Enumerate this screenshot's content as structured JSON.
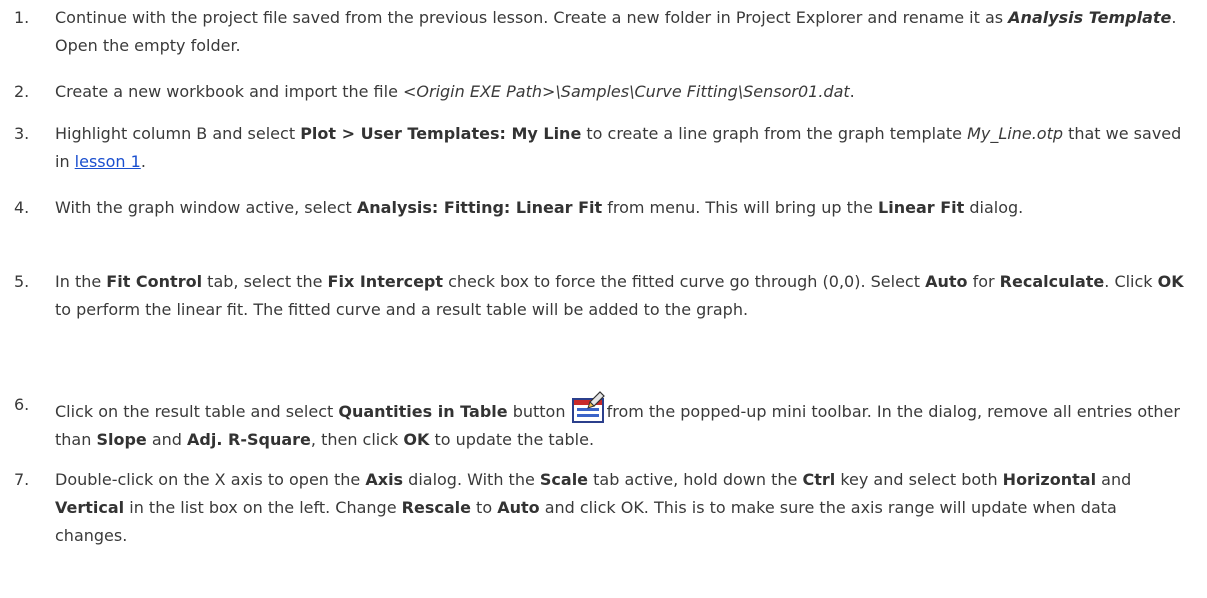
{
  "steps": [
    {
      "number": "1.",
      "parts": [
        {
          "t": "Continue with the project file saved from the previous lesson. Create a new folder in Project Explorer and rename it as "
        },
        {
          "t": "Analysis Template",
          "b": true,
          "i": true
        },
        {
          "t": ". Open the empty folder."
        }
      ]
    },
    {
      "number": "2.",
      "parts": [
        {
          "t": "Create a new workbook and import the file "
        },
        {
          "t": "<Origin EXE Path>\\Samples\\Curve Fitting\\Sensor01.dat",
          "i": true
        },
        {
          "t": "."
        }
      ]
    },
    {
      "number": "3.",
      "parts": [
        {
          "t": "Highlight column B and select "
        },
        {
          "t": "Plot > User Templates: My Line",
          "b": true
        },
        {
          "t": " to create a line graph from the graph template "
        },
        {
          "t": "My_Line.otp",
          "i": true
        },
        {
          "t": " that we saved in "
        },
        {
          "t": "lesson 1",
          "link": true
        },
        {
          "t": "."
        }
      ]
    },
    {
      "number": "4.",
      "parts": [
        {
          "t": "With the graph window active, select "
        },
        {
          "t": "Analysis: Fitting: Linear Fit",
          "b": true
        },
        {
          "t": " from menu. This will bring up the "
        },
        {
          "t": "Linear Fit",
          "b": true
        },
        {
          "t": " dialog."
        }
      ]
    },
    {
      "number": "5.",
      "parts": [
        {
          "t": "In the "
        },
        {
          "t": "Fit Control",
          "b": true
        },
        {
          "t": " tab, select the "
        },
        {
          "t": "Fix Intercept",
          "b": true
        },
        {
          "t": " check box to force the fitted curve go through (0,0). Select "
        },
        {
          "t": "Auto",
          "b": true
        },
        {
          "t": " for "
        },
        {
          "t": "Recalculate",
          "b": true
        },
        {
          "t": ". Click "
        },
        {
          "t": "OK",
          "b": true
        },
        {
          "t": " to perform the linear fit. The fitted curve and a result table will be added to the graph."
        }
      ]
    },
    {
      "number": "6.",
      "parts": [
        {
          "t": "Click on the result table and select "
        },
        {
          "t": "Quantities in Table",
          "b": true
        },
        {
          "t": " button "
        },
        {
          "icon": "quantities-in-table-icon"
        },
        {
          "t": "from the popped-up mini toolbar. In the dialog, remove all entries other than "
        },
        {
          "t": "Slope",
          "b": true
        },
        {
          "t": " and "
        },
        {
          "t": "Adj. R-Square",
          "b": true
        },
        {
          "t": ", then click "
        },
        {
          "t": "OK",
          "b": true
        },
        {
          "t": " to update the table."
        }
      ]
    },
    {
      "number": "7.",
      "parts": [
        {
          "t": "Double-click on the X axis to open the "
        },
        {
          "t": "Axis",
          "b": true
        },
        {
          "t": " dialog. With the "
        },
        {
          "t": "Scale",
          "b": true
        },
        {
          "t": " tab active, hold down the "
        },
        {
          "t": "Ctrl",
          "b": true
        },
        {
          "t": " key and select both "
        },
        {
          "t": "Horizontal",
          "b": true
        },
        {
          "t": " and "
        },
        {
          "t": "Vertical",
          "b": true
        },
        {
          "t": " in the list box on the left. Change "
        },
        {
          "t": "Rescale",
          "b": true
        },
        {
          "t": " to "
        },
        {
          "t": "Auto",
          "b": true
        },
        {
          "t": " and click OK. This is to make sure the axis range will update when data changes."
        }
      ]
    }
  ]
}
